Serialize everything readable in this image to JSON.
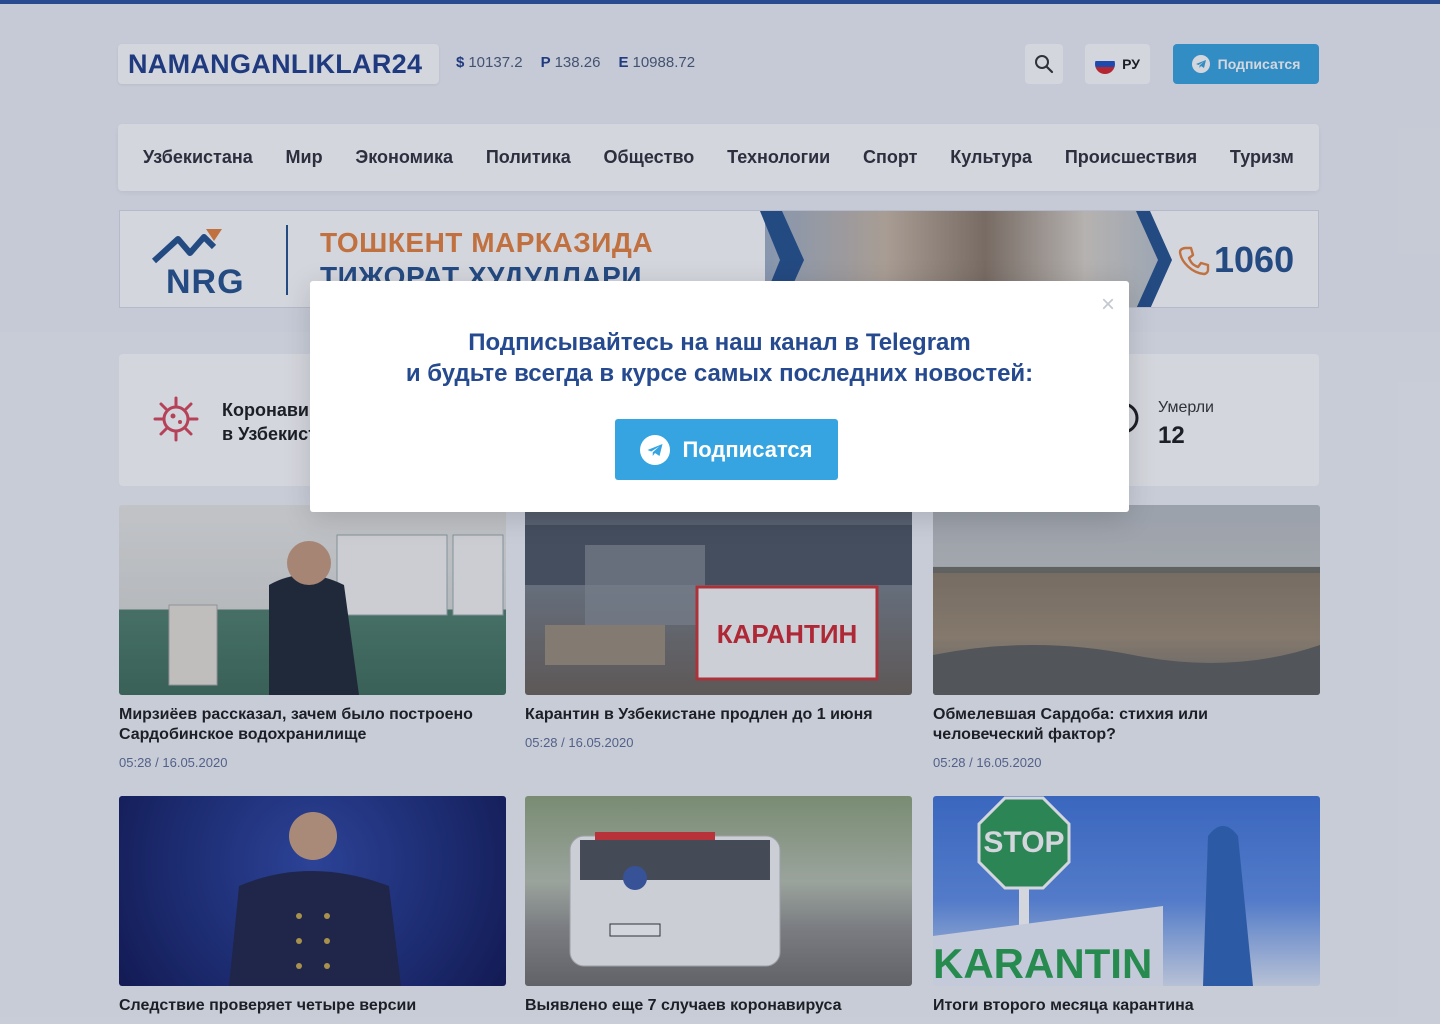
{
  "header": {
    "logo": "NAMANGANLIKLAR24",
    "rates": [
      {
        "symbol": "$",
        "value": "10137.2"
      },
      {
        "symbol": "Р",
        "value": "138.26"
      },
      {
        "symbol": "Е",
        "value": "10988.72"
      }
    ],
    "lang_label": "РУ",
    "subscribe_label": "Подписатся"
  },
  "nav": [
    "Узбекистана",
    "Мир",
    "Экономика",
    "Политика",
    "Общество",
    "Технологии",
    "Спорт",
    "Культура",
    "Происшествия",
    "Туризм"
  ],
  "banner": {
    "brand": "NRG",
    "line1": "ТОШКЕНТ МАРКАЗИДА",
    "line2": "ТИЖОРАТ ХУДУДЛАРИ",
    "phone": "1060"
  },
  "covid": {
    "title_line1": "Коронавирус",
    "title_line2": "в Узбекистане",
    "dead_label": "Умерли",
    "dead_value": "12"
  },
  "cards": [
    {
      "title": "Мирзиёев рассказал, зачем было построено Сардобинское водохранилище",
      "date": "05:28 / 16.05.2020"
    },
    {
      "title": "Карантин в Узбекистане продлен до 1 июня",
      "date": "05:28 / 16.05.2020",
      "img_text": "КАРАНТИН"
    },
    {
      "title": "Обмелевшая Сардоба: стихия или человеческий фактор?",
      "date": "05:28 / 16.05.2020"
    },
    {
      "title": "Следствие проверяет четыре версии"
    },
    {
      "title": "Выявлено еще 7 случаев коронавируса"
    },
    {
      "title": "Итоги второго месяца карантина",
      "img_text": "KARANTIN",
      "img_sign": "STOP"
    }
  ],
  "modal": {
    "line1": "Подписывайтесь на наш канал в Telegram",
    "line2": "и будьте всегда в курсе самых последних новостей:",
    "button_label": "Подписатся",
    "close": "×"
  },
  "colors": {
    "accent": "#35a4e0",
    "brand": "#1e3d8a"
  }
}
